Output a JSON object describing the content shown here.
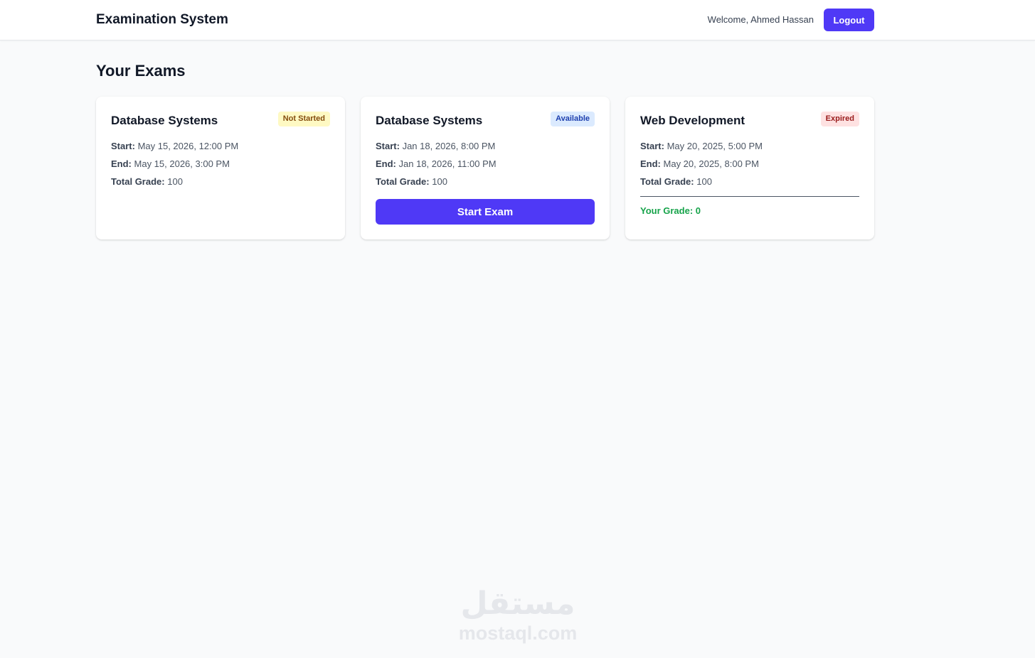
{
  "header": {
    "brand": "Examination System",
    "welcome": "Welcome, Ahmed Hassan",
    "logout_label": "Logout"
  },
  "main": {
    "title": "Your Exams",
    "exams": [
      {
        "title": "Database Systems",
        "status": "Not Started",
        "start_label": "Start:",
        "start_value": "May 15, 2026, 12:00 PM",
        "end_label": "End:",
        "end_value": "May 15, 2026, 3:00 PM",
        "grade_label": "Total Grade:",
        "grade_value": "100"
      },
      {
        "title": "Database Systems",
        "status": "Available",
        "start_label": "Start:",
        "start_value": "Jan 18, 2026, 8:00 PM",
        "end_label": "End:",
        "end_value": "Jan 18, 2026, 11:00 PM",
        "grade_label": "Total Grade:",
        "grade_value": "100",
        "action_label": "Start Exam"
      },
      {
        "title": "Web Development",
        "status": "Expired",
        "start_label": "Start:",
        "start_value": "May 20, 2025, 5:00 PM",
        "end_label": "End:",
        "end_value": "May 20, 2025, 8:00 PM",
        "grade_label": "Total Grade:",
        "grade_value": "100",
        "your_grade": "Your Grade: 0"
      }
    ]
  },
  "watermark": {
    "arabic": "مستقل",
    "latin": "mostaql.com"
  },
  "colors": {
    "primary": "#4f39f6",
    "badge_not_started_bg": "#fef9c3",
    "badge_not_started_fg": "#854d0e",
    "badge_available_bg": "#dbeafe",
    "badge_available_fg": "#1e40af",
    "badge_expired_bg": "#fee2e2",
    "badge_expired_fg": "#991b1b",
    "grade_green": "#16a34a"
  }
}
